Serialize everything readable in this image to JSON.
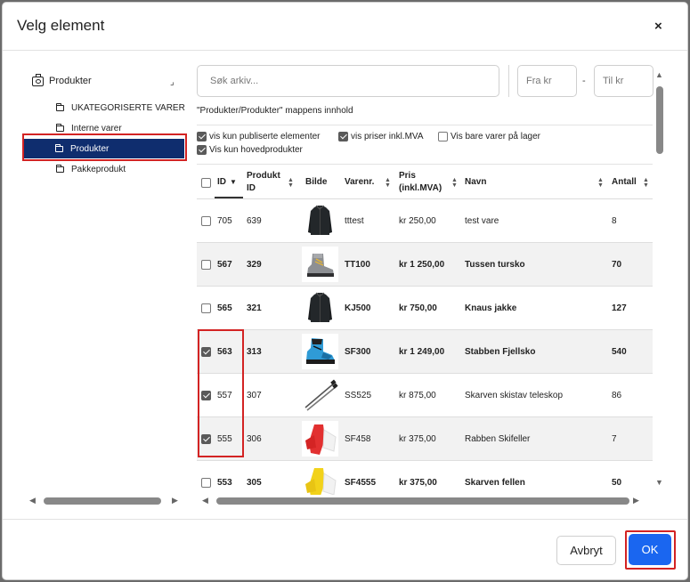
{
  "dialog": {
    "title": "Velg element",
    "close_glyph": "×"
  },
  "tree": {
    "root_label": "Produkter",
    "expand_glyph": "⌟",
    "items": [
      {
        "label": "UKATEGORISERTE VARER",
        "selected": false
      },
      {
        "label": "Interne varer",
        "selected": false
      },
      {
        "label": "Produkter",
        "selected": true
      },
      {
        "label": "Pakkeprodukt",
        "selected": false
      }
    ]
  },
  "search": {
    "placeholder": "Søk arkiv...",
    "value": ""
  },
  "price_filter": {
    "from_placeholder": "Fra kr",
    "to_placeholder": "Til kr",
    "separator": "-"
  },
  "folder_info": "\"Produkter/Produkter\" mappens innhold",
  "filters": [
    {
      "label": "vis kun publiserte elementer",
      "checked": true
    },
    {
      "label": "vis priser inkl.MVA",
      "checked": true
    },
    {
      "label": "Vis bare varer på lager",
      "checked": false
    },
    {
      "label": "Vis kun hovedprodukter",
      "checked": true
    }
  ],
  "table": {
    "headers": {
      "id": "ID",
      "produkt_id_1": "Produkt",
      "produkt_id_2": "ID",
      "bilde": "Bilde",
      "varenr": "Varenr.",
      "pris_1": "Pris",
      "pris_2": "(inkl.MVA)",
      "navn": "Navn",
      "antall": "Antall"
    },
    "rows": [
      {
        "checked": false,
        "bold": false,
        "id": "705",
        "pid": "639",
        "image": "jacket-icon",
        "varenr": "tttest",
        "pris": "kr 250,00",
        "navn": "test vare",
        "antall": "8"
      },
      {
        "checked": false,
        "bold": true,
        "id": "567",
        "pid": "329",
        "image": "hiking-boot-icon",
        "varenr": "TT100",
        "pris": "kr 1 250,00",
        "navn": "Tussen tursko",
        "antall": "70"
      },
      {
        "checked": false,
        "bold": true,
        "id": "565",
        "pid": "321",
        "image": "jacket-icon",
        "varenr": "KJ500",
        "pris": "kr 750,00",
        "navn": "Knaus jakke",
        "antall": "127"
      },
      {
        "checked": true,
        "bold": true,
        "id": "563",
        "pid": "313",
        "image": "mountain-boot-icon",
        "varenr": "SF300",
        "pris": "kr 1 249,00",
        "navn": "Stabben Fjellsko",
        "antall": "540"
      },
      {
        "checked": true,
        "bold": false,
        "id": "557",
        "pid": "307",
        "image": "ski-poles-icon",
        "varenr": "SS525",
        "pris": "kr 875,00",
        "navn": "Skarven skistav teleskop",
        "antall": "86"
      },
      {
        "checked": true,
        "bold": false,
        "id": "555",
        "pid": "306",
        "image": "ski-skins-icon",
        "varenr": "SF458",
        "pris": "kr 375,00",
        "navn": "Rabben Skifeller",
        "antall": "7"
      },
      {
        "checked": false,
        "bold": true,
        "id": "553",
        "pid": "305",
        "image": "ski-skins-icon",
        "varenr": "SF4555",
        "pris": "kr 375,00",
        "navn": "Skarven fellen",
        "antall": "50"
      }
    ]
  },
  "footer": {
    "cancel_label": "Avbryt",
    "ok_label": "OK"
  },
  "colors": {
    "selected_tree_bg": "#0f2d6e",
    "ok_button": "#1a66f0",
    "highlight_outline": "#d32323"
  }
}
